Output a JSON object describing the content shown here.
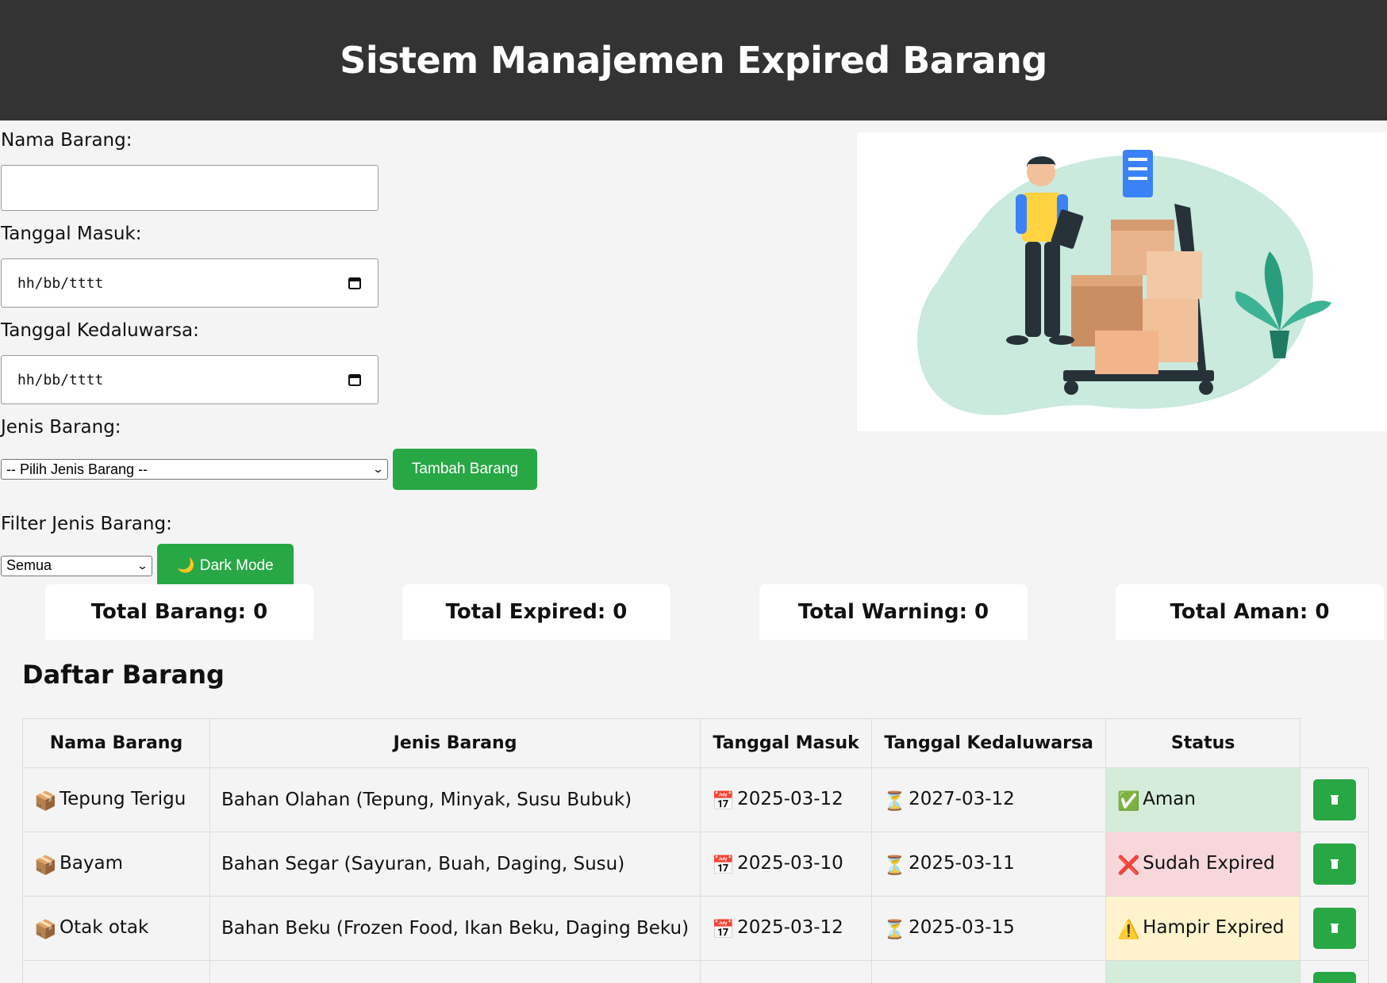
{
  "header": {
    "title": "Sistem Manajemen Expired Barang"
  },
  "form": {
    "nama_label": "Nama Barang:",
    "nama_value": "",
    "tgl_masuk_label": "Tanggal Masuk:",
    "tgl_masuk_placeholder": "hh/bb/tttt",
    "tgl_exp_label": "Tanggal Kedaluwarsa:",
    "tgl_exp_placeholder": "hh/bb/tttt",
    "jenis_label": "Jenis Barang:",
    "jenis_selected": "-- Pilih Jenis Barang --",
    "tambah_button": "Tambah Barang",
    "filter_label": "Filter Jenis Barang:",
    "filter_selected": "Semua",
    "dark_mode_icon": "🌙",
    "dark_mode_button": "Dark Mode"
  },
  "stats": {
    "total_barang": "Total Barang: 0",
    "total_expired": "Total Expired: 0",
    "total_warning": "Total Warning: 0",
    "total_aman": "Total Aman: 0"
  },
  "list": {
    "title": "Daftar Barang",
    "columns": [
      "Nama Barang",
      "Jenis Barang",
      "Tanggal Masuk",
      "Tanggal Kedaluwarsa",
      "Status"
    ],
    "rows": [
      {
        "icon": "📦",
        "nama": "Tepung Terigu",
        "jenis": "Bahan Olahan (Tepung, Minyak, Susu Bubuk)",
        "masuk_icon": "📅",
        "masuk": "2025-03-12",
        "exp_icon": "⏳",
        "exp": "2027-03-12",
        "status_icon": "✅",
        "status": "Aman"
      },
      {
        "icon": "📦",
        "nama": "Bayam",
        "jenis": "Bahan Segar (Sayuran, Buah, Daging, Susu)",
        "masuk_icon": "📅",
        "masuk": "2025-03-10",
        "exp_icon": "⏳",
        "exp": "2025-03-11",
        "status_icon": "❌",
        "status": "Sudah Expired"
      },
      {
        "icon": "📦",
        "nama": "Otak otak",
        "jenis": "Bahan Beku (Frozen Food, Ikan Beku, Daging Beku)",
        "masuk_icon": "📅",
        "masuk": "2025-03-12",
        "exp_icon": "⏳",
        "exp": "2025-03-15",
        "status_icon": "⚠️",
        "status": "Hampir Expired"
      }
    ]
  },
  "colors": {
    "header_bg": "#333333",
    "accent_green": "#28a745",
    "aman_bg": "#d4edda",
    "expired_bg": "#f8d7da",
    "warning_bg": "#fff3cd"
  }
}
